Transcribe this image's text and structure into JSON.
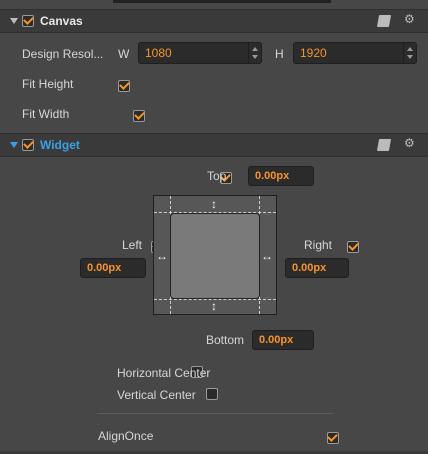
{
  "canvas": {
    "title": "Canvas",
    "design_resolution_label": "Design Resol...",
    "w_label": "W",
    "width": "1080",
    "h_label": "H",
    "height": "1920",
    "fit_height_label": "Fit Height",
    "fit_width_label": "Fit Width",
    "enabled": true,
    "fit_height": true,
    "fit_width": true
  },
  "widget": {
    "title": "Widget",
    "enabled": true,
    "top": {
      "label": "Top",
      "value": "0.00px",
      "checked": true
    },
    "left": {
      "label": "Left",
      "value": "0.00px",
      "checked": true
    },
    "right": {
      "label": "Right",
      "value": "0.00px",
      "checked": true
    },
    "bottom": {
      "label": "Bottom",
      "value": "0.00px",
      "checked": true
    },
    "horizontal_center_label": "Horizontal Center",
    "vertical_center_label": "Vertical Center",
    "align_once_label": "AlignOnce",
    "align_once": true
  },
  "icons": {
    "header_triangle": "expand-triangle-icon",
    "book": "book-icon",
    "settings": "gear-icon"
  },
  "colors": {
    "accent_orange": "#f7942a",
    "accent_blue": "#39a1e8",
    "panel_bg": "#474747",
    "header_bg": "#3a3a3a"
  }
}
